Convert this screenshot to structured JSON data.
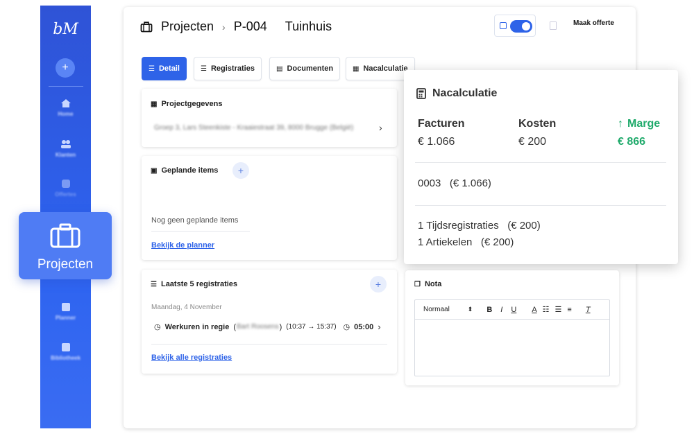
{
  "sidebar": {
    "logo": "bM",
    "items": [
      {
        "label": "Home",
        "icon": "home-icon"
      },
      {
        "label": "Klanten",
        "icon": "users-icon"
      },
      {
        "label": "Offertes",
        "icon": "inbox-icon"
      },
      {
        "label": "Projecten",
        "icon": "briefcase-icon"
      },
      {
        "label": "Planner",
        "icon": "calendar-icon"
      },
      {
        "label": "Bibliotheek",
        "icon": "book-icon"
      }
    ],
    "add_label": "+"
  },
  "header": {
    "crumb_root": "Projecten",
    "crumb_sep": "›",
    "project_code": "P-004",
    "project_name": "Tuinhuis",
    "offer_button": "Maak offerte"
  },
  "tabs": [
    {
      "label": "Detail",
      "icon": "list-icon",
      "active": true
    },
    {
      "label": "Registraties",
      "icon": "list-icon",
      "active": false
    },
    {
      "label": "Documenten",
      "icon": "document-icon",
      "active": false
    },
    {
      "label": "Nacalculatie",
      "icon": "calculator-icon",
      "active": false
    }
  ],
  "projectgegevens": {
    "title": "Projectgegevens",
    "address": "Groep 3, Lars Steenkiste - Kraaiestraat 39, 8000 Brugge (België)",
    "chevron": "›"
  },
  "gepland": {
    "title": "Geplande items",
    "empty": "Nog geen geplande items",
    "link": "Bekijk de planner"
  },
  "registraties": {
    "title": "Laatste 5 registraties",
    "date": "Maandag, 4 November",
    "entry_label": "Werkuren in regie",
    "entry_person": "Bart Roosens",
    "entry_time": "(10:37 → 15:37)",
    "entry_duration": "05:00",
    "link": "Bekijk alle registraties"
  },
  "nacalculatie": {
    "title": "Nacalculatie",
    "facturen_label": "Facturen",
    "facturen_value": "€ 1.066",
    "kosten_label": "Kosten",
    "kosten_value": "€ 200",
    "marge_label": "Marge",
    "marge_value": "€ 866",
    "invoice_line": "0003   (€ 1.066)",
    "cost_line_1": "1 Tijdsregistraties   (€ 200)",
    "cost_line_2": "1 Artiekelen   (€ 200)",
    "accent": "#1faa6b"
  },
  "nota": {
    "title": "Nota",
    "format": "Normaal"
  },
  "colors": {
    "primary": "#2e63e8",
    "sidebar": "#2f53d6"
  }
}
